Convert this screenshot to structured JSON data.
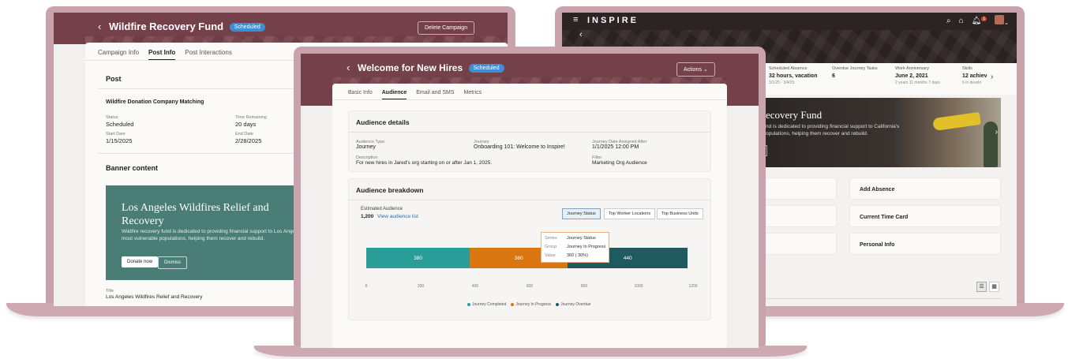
{
  "left": {
    "title": "Wildfire Recovery Fund",
    "badge": "Scheduled",
    "delete_btn": "Delete Campaign",
    "tabs": [
      "Campaign Info",
      "Post Info",
      "Post Interactions"
    ],
    "post_heading": "Post",
    "post_name": "Wildfire Donation Company Matching",
    "status_label": "Status",
    "status_value": "Scheduled",
    "time_label": "Time Remaining",
    "time_value": "20 days",
    "start_label": "Start Date",
    "start_value": "1/15/2025",
    "end_label": "End Date",
    "end_value": "2/28/2025",
    "banner_heading": "Banner content",
    "banner_title": "Los Angeles Wildfires Relief and Recovery",
    "banner_text": "Wildfire recovery fund is dedicated to providing financial support to Los Angeles' most vulnerable populations, helping them recover and rebuild.",
    "donate_btn": "Donate now",
    "dismiss_btn": "Dismiss",
    "title_label": "Title",
    "title_value": "Los Angeles Wildfires Relief and Recovery"
  },
  "right": {
    "logo": "INSPIRE",
    "stats": [
      {
        "label": "Scheduled Absence",
        "value": "32 hours, vacation",
        "sub": "3/1/25 - 3/4/25"
      },
      {
        "label": "Overdue Journey Tasks",
        "value": "6",
        "sub": ""
      },
      {
        "label": "Work Anniversary",
        "value": "June 2, 2021",
        "sub": "2 years 11 months 7 days"
      },
      {
        "label": "Skills",
        "value": "12 achiev",
        "sub": "6 in develo"
      }
    ],
    "hero_title": "ecovery Fund",
    "hero_text": "nd is dedicated to providing financial support to California's opulations, helping them recover and rebuild.",
    "quick_actions": [
      "Add Absence",
      "Current Time Card",
      "Personal Info"
    ],
    "notif_count": "1"
  },
  "center": {
    "title": "Welcome for New Hires",
    "badge": "Scheduled",
    "actions_btn": "Actions",
    "tabs": [
      "Basic Info",
      "Audience",
      "Email and SMS",
      "Metrics"
    ],
    "details_heading": "Audience details",
    "audience_type_label": "Audience Type",
    "audience_type_value": "Journey",
    "journey_label": "Journey",
    "journey_value": "Onboarding 101: Welcome to Inspire!",
    "assigned_label": "Journey Date Assigned After",
    "assigned_value": "1/1/2025 12:00 PM",
    "description_label": "Description",
    "description_value": "For new hires in Jared's org starting on or after Jan 1, 2025.",
    "filter_label": "Filter",
    "filter_value": "Marketing Org Audience",
    "breakdown_heading": "Audience breakdown",
    "estimated_label": "Estimated Audience",
    "estimated_value": "1,200",
    "view_link": "View audience list",
    "seg_buttons": [
      "Journey Status",
      "Top Worker Locations",
      "Top Business Units"
    ],
    "tooltip": {
      "series_k": "Series",
      "series_v": "Journey Status",
      "group_k": "Group",
      "group_v": "Journey In Progress",
      "value_k": "Value",
      "value_v": "360 ( 30%)"
    }
  },
  "colors": {
    "completed": "#2a9d98",
    "in_progress": "#d9760f",
    "overdue": "#1f5a5f",
    "maroon": "#74404a",
    "banner_green": "#4a7d75"
  },
  "chart_data": {
    "type": "bar",
    "orientation": "horizontal-stacked",
    "categories": [
      "Journey Status"
    ],
    "series": [
      {
        "name": "Journey Completed",
        "values": [
          380
        ]
      },
      {
        "name": "Journey In Progress",
        "values": [
          360
        ]
      },
      {
        "name": "Journey Overdue",
        "values": [
          440
        ]
      }
    ],
    "xticks": [
      "0",
      "200",
      "400",
      "600",
      "800",
      "1000",
      "1200"
    ],
    "xlim": [
      0,
      1200
    ],
    "legend": "bottom"
  }
}
